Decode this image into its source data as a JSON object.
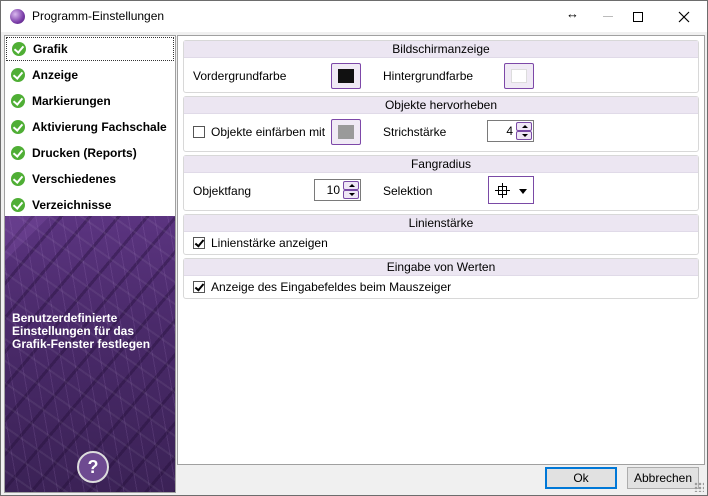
{
  "window": {
    "title": "Programm-Einstellungen",
    "resize_arrow": "↔"
  },
  "sidebar": {
    "items": [
      {
        "label": "Grafik",
        "selected": true
      },
      {
        "label": "Anzeige"
      },
      {
        "label": "Markierungen"
      },
      {
        "label": "Aktivierung Fachschale"
      },
      {
        "label": "Drucken (Reports)"
      },
      {
        "label": "Verschiedenes"
      },
      {
        "label": "Verzeichnisse"
      }
    ],
    "description": "Benutzerdefinierte Einstellungen für das Grafik-Fenster festlegen",
    "help_symbol": "?"
  },
  "groups": {
    "bildschirm": {
      "title": "Bildschirmanzeige",
      "foreground_label": "Vordergrundfarbe",
      "foreground_color": "#111111",
      "background_label": "Hintergrundfarbe",
      "background_color": "#ffffff"
    },
    "objekte": {
      "title": "Objekte hervorheben",
      "colorize_label": "Objekte einfärben mit",
      "colorize_checked": false,
      "colorize_color": "#9a9a9a",
      "stroke_label": "Strichstärke",
      "stroke_value": "4"
    },
    "fangradius": {
      "title": "Fangradius",
      "snap_label": "Objektfang",
      "snap_value": "10",
      "selection_label": "Selektion",
      "selection_icon": "crosshair-icon"
    },
    "linienstaerke": {
      "title": "Linienstärke",
      "show_label": "Linienstärke anzeigen",
      "show_checked": true
    },
    "eingabe": {
      "title": "Eingabe von Werten",
      "show_label": "Anzeige des Eingabefeldes beim Mauszeiger",
      "show_checked": true
    }
  },
  "buttons": {
    "ok": "Ok",
    "cancel": "Abbrechen"
  }
}
